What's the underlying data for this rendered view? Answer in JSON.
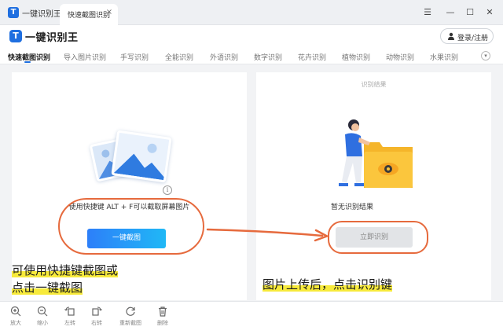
{
  "window": {
    "app_title": "一键识别王",
    "tab_title": "快速截图识别",
    "tab_close": "×",
    "controls": {
      "menu": "☰",
      "minimize": "—",
      "maximize": "☐",
      "close": "✕"
    }
  },
  "header": {
    "logo_mark": "T",
    "logo_text": "一键识别王",
    "login_label": "登录/注册"
  },
  "modes": [
    "快速截图识别",
    "导入图片识别",
    "手写识别",
    "全能识别",
    "外语识别",
    "数字识别",
    "花卉识别",
    "植物识别",
    "动物识别",
    "水果识别"
  ],
  "mode_active_index": 0,
  "left_panel": {
    "hint_icon": "i",
    "hint_text": "使用快捷键 ALT + F可以截取屏幕图片",
    "capture_button": "一键截图"
  },
  "right_panel": {
    "header": "识别结果",
    "no_result": "暂无识别结果",
    "recognize_button": "立即识别"
  },
  "annotations": {
    "left_line1": "可使用快捷键截图或",
    "left_line2": "点击一键截图",
    "right": "图片上传后，点击识别键",
    "color": "#e66a3d",
    "highlight": "#f7ea3b"
  },
  "toolbar": [
    {
      "name": "zoom-in",
      "label": "放大"
    },
    {
      "name": "zoom-out",
      "label": "缩小"
    },
    {
      "name": "rotate-left",
      "label": "左转"
    },
    {
      "name": "rotate-right",
      "label": "右转"
    },
    {
      "name": "recapture",
      "label": "重新截图"
    },
    {
      "name": "delete",
      "label": "删除"
    }
  ],
  "colors": {
    "accent": "#1f6fe0",
    "button_gradient_end": "#20b8f6"
  }
}
